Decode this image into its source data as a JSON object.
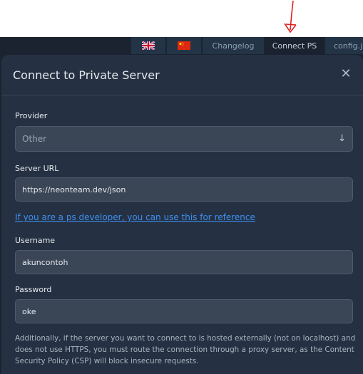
{
  "nav": {
    "items": [
      {
        "label": "Changelog"
      },
      {
        "label": "Connect PS"
      },
      {
        "label": "config.js"
      }
    ],
    "flag_uk_icon": "uk-flag-icon",
    "flag_cn_icon": "china-flag-icon"
  },
  "modal": {
    "title": "Connect to Private Server",
    "close_icon": "close-icon",
    "provider": {
      "label": "Provider",
      "value": "Other",
      "arrow": "↓"
    },
    "server_url": {
      "label": "Server URL",
      "value": "https://neonteam.dev/json"
    },
    "reference_link": "If you are a ps developer, you can use this for reference",
    "username": {
      "label": "Username",
      "value": "akuncontoh"
    },
    "password": {
      "label": "Password",
      "value": "oke"
    },
    "note": "Additionally, if the server you want to connect to is hosted externally (not on localhost) and does not use HTTPS, you must route the connection through a proxy server, as the Content Security Policy (CSP) will block insecure requests."
  },
  "colors": {
    "accent_link": "#3d8ff0",
    "annotation_red": "#e02020",
    "modal_bg": "#253142"
  }
}
